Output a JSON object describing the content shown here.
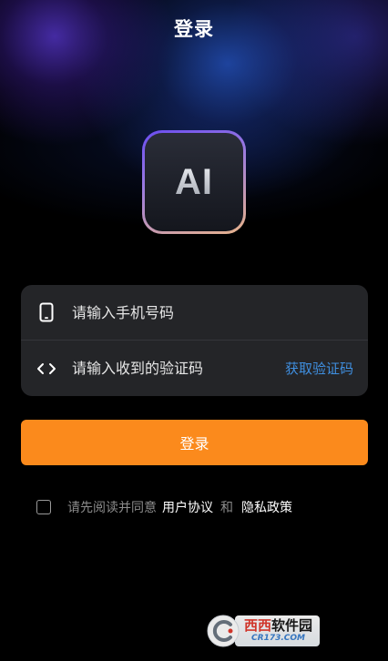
{
  "header": {
    "title": "登录"
  },
  "logo": {
    "text": "AI"
  },
  "form": {
    "phone_placeholder": "请输入手机号码",
    "code_placeholder": "请输入收到的验证码",
    "get_code_label": "获取验证码"
  },
  "login_button_label": "登录",
  "agreement": {
    "prefix": "请先阅读并同意",
    "user_agreement": "用户协议",
    "and": "和",
    "privacy_policy": "隐私政策",
    "checked": false
  },
  "watermark": {
    "brand_red": "西西",
    "brand_dark": "软件园",
    "url": "CR173.COM"
  },
  "colors": {
    "accent": "#fb8a1c",
    "link": "#3f8fe0",
    "card": "#242528",
    "background": "#000000"
  },
  "icons": [
    "phone-icon",
    "code-brackets-icon",
    "watermark-logo-icon"
  ]
}
